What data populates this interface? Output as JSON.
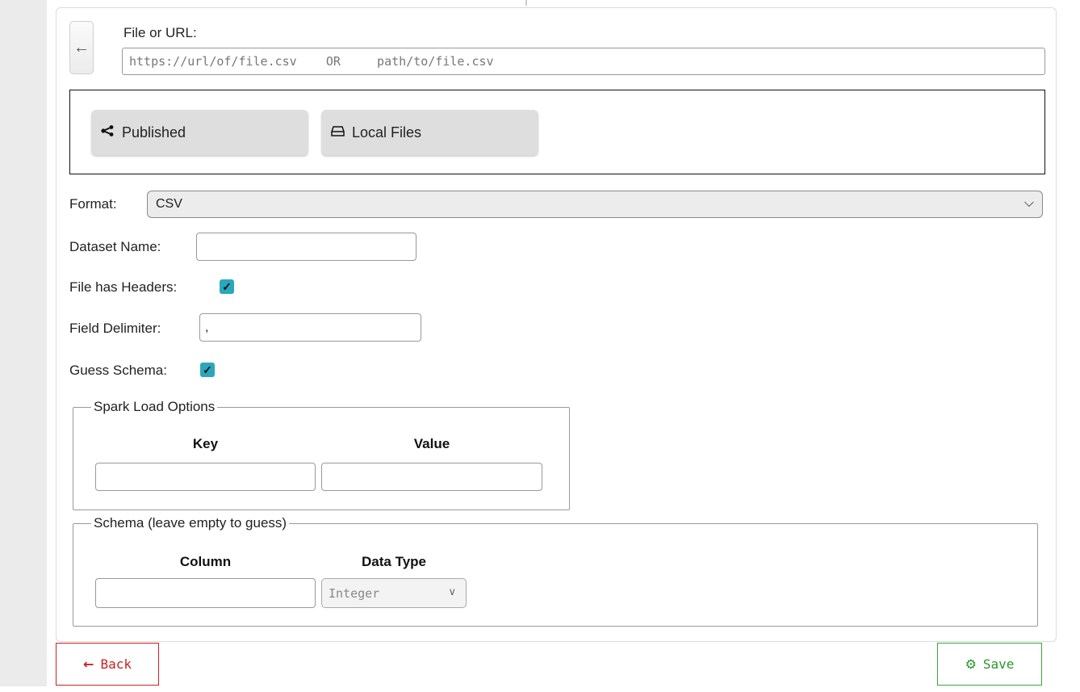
{
  "file_source": {
    "label": "File or URL:",
    "placeholder": "https://url/of/file.csv    OR     path/to/file.csv",
    "back_icon": "arrow-left-icon"
  },
  "sources": {
    "published_label": "Published",
    "published_icon": "share-icon",
    "local_label": "Local Files",
    "local_icon": "hard-drive-icon"
  },
  "format": {
    "label": "Format:",
    "value": "CSV"
  },
  "dataset_name": {
    "label": "Dataset Name:",
    "value": ""
  },
  "headers": {
    "label": "File has Headers:",
    "checked": true
  },
  "delimiter": {
    "label": "Field Delimiter:",
    "value": ","
  },
  "guess_schema": {
    "label": "Guess Schema:",
    "checked": true
  },
  "spark_options": {
    "legend": "Spark Load Options",
    "key_header": "Key",
    "value_header": "Value"
  },
  "schema": {
    "legend": "Schema (leave empty to guess)",
    "column_header": "Column",
    "type_header": "Data Type",
    "type_value": "Integer"
  },
  "footer": {
    "back_label": "Back",
    "save_label": "Save"
  },
  "colors": {
    "accent_checkbox": "#2aa7bd",
    "back_red": "#cc2222",
    "save_green": "#2a962a"
  }
}
